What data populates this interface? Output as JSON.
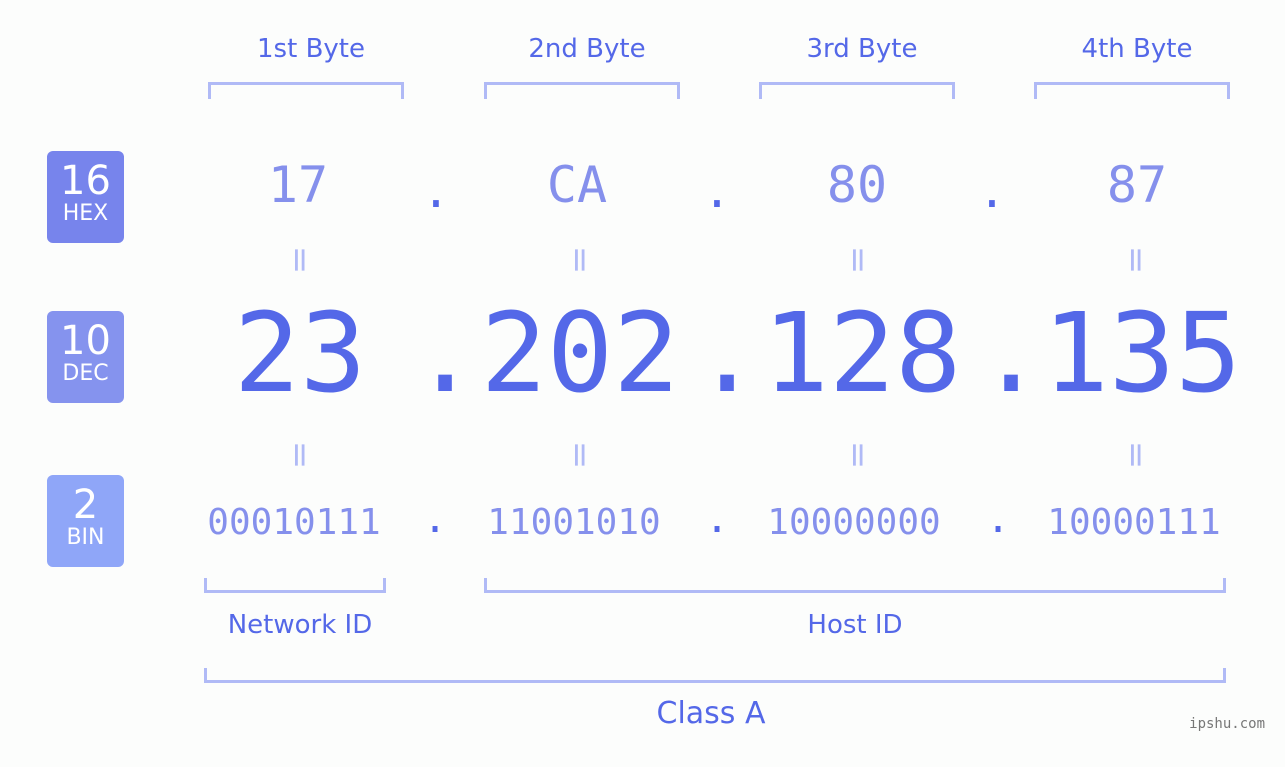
{
  "byte_headers": [
    "1st Byte",
    "2nd Byte",
    "3rd Byte",
    "4th Byte"
  ],
  "badges": {
    "hex": {
      "base": "16",
      "label": "HEX",
      "color": "#7784ec"
    },
    "dec": {
      "base": "10",
      "label": "DEC",
      "color": "#8593ee"
    },
    "bin": {
      "base": "2",
      "label": "BIN",
      "color": "#8fa6f8"
    }
  },
  "hex": [
    "17",
    "CA",
    "80",
    "87"
  ],
  "dec": [
    "23",
    "202",
    "128",
    "135"
  ],
  "bin": [
    "00010111",
    "11001010",
    "10000000",
    "10000111"
  ],
  "separator": ".",
  "equals": "=",
  "network_label": "Network ID",
  "host_label": "Host ID",
  "class_label": "Class A",
  "watermark": "ipshu.com",
  "colors": {
    "accent": "#5468e8",
    "light": "#8590ec",
    "bracket": "#b0baf6"
  }
}
